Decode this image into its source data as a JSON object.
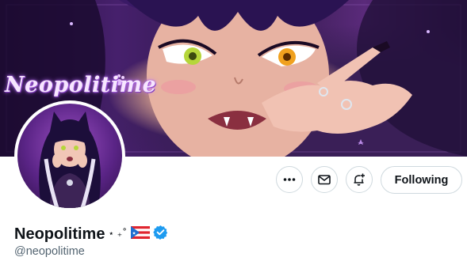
{
  "banner": {
    "logo_text": "Neopolitime"
  },
  "profile": {
    "display_name": "Neopolitime",
    "name_decoration": "⋆ ₊˚",
    "flag_icon": "puerto-rico-flag-icon",
    "verified_icon": "verified-badge-icon",
    "handle": "@neopolitime"
  },
  "actions": {
    "more_icon": "more-options-icon",
    "message_icon": "envelope-icon",
    "notify_icon": "bell-plus-icon",
    "following_label": "Following"
  },
  "colors": {
    "accent_blue": "#1d9bf0",
    "text_primary": "#0f1419",
    "text_secondary": "#536471",
    "border": "#cfd9de"
  }
}
